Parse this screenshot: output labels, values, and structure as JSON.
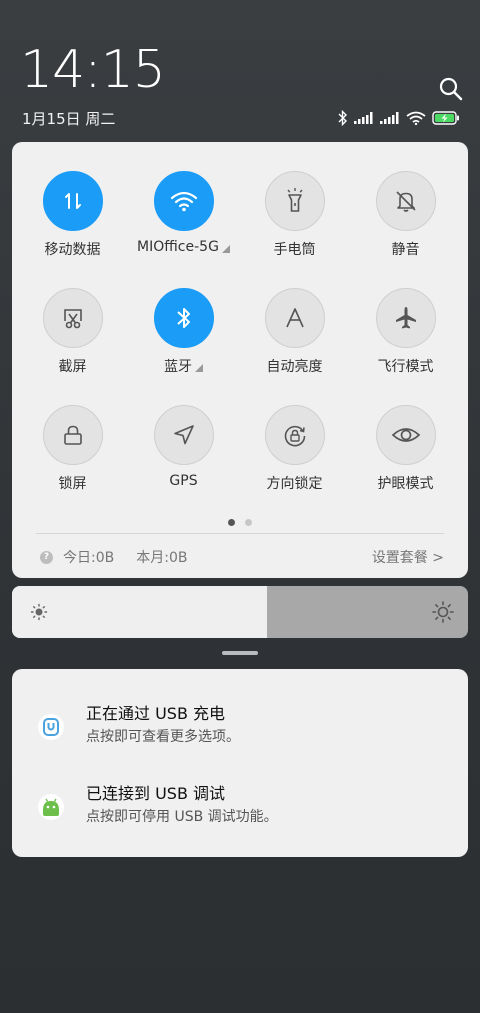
{
  "lock": {
    "time": "14:15",
    "date": "1月15日 周二"
  },
  "status": {
    "icons": [
      "bluetooth-icon",
      "signal-icon",
      "signal-icon",
      "wifi-icon",
      "battery-charging-icon"
    ]
  },
  "quick_settings": {
    "tiles": [
      {
        "label": "移动数据",
        "icon": "mobile-data-icon",
        "active": true,
        "expandable": false
      },
      {
        "label": "MIOffice-5G",
        "icon": "wifi-icon",
        "active": true,
        "expandable": true
      },
      {
        "label": "手电筒",
        "icon": "flashlight-icon",
        "active": false,
        "expandable": false
      },
      {
        "label": "静音",
        "icon": "mute-bell-icon",
        "active": false,
        "expandable": false
      },
      {
        "label": "截屏",
        "icon": "screenshot-icon",
        "active": false,
        "expandable": false
      },
      {
        "label": "蓝牙",
        "icon": "bluetooth-icon",
        "active": true,
        "expandable": true
      },
      {
        "label": "自动亮度",
        "icon": "auto-brightness-icon",
        "active": false,
        "expandable": false
      },
      {
        "label": "飞行模式",
        "icon": "airplane-icon",
        "active": false,
        "expandable": false
      },
      {
        "label": "锁屏",
        "icon": "lock-icon",
        "active": false,
        "expandable": false
      },
      {
        "label": "GPS",
        "icon": "location-icon",
        "active": false,
        "expandable": false
      },
      {
        "label": "方向锁定",
        "icon": "rotation-lock-icon",
        "active": false,
        "expandable": false
      },
      {
        "label": "护眼模式",
        "icon": "eye-icon",
        "active": false,
        "expandable": false
      }
    ],
    "page_count": 2,
    "current_page": 1,
    "usage_today": "今日:0B",
    "usage_month": "本月:0B",
    "plan_link": "设置套餐 >"
  },
  "brightness": {
    "level": 0.56
  },
  "notifications": [
    {
      "title": "正在通过 USB 充电",
      "desc": "点按即可查看更多选项。",
      "icon": "usb-icon",
      "color": "#4aa3df"
    },
    {
      "title": "已连接到 USB 调试",
      "desc": "点按即可停用 USB 调试功能。",
      "icon": "android-icon",
      "color": "#6cbf4a"
    }
  ],
  "colors": {
    "active_tile": "#1a9cf7",
    "panel_bg": "#f0f0f0"
  }
}
